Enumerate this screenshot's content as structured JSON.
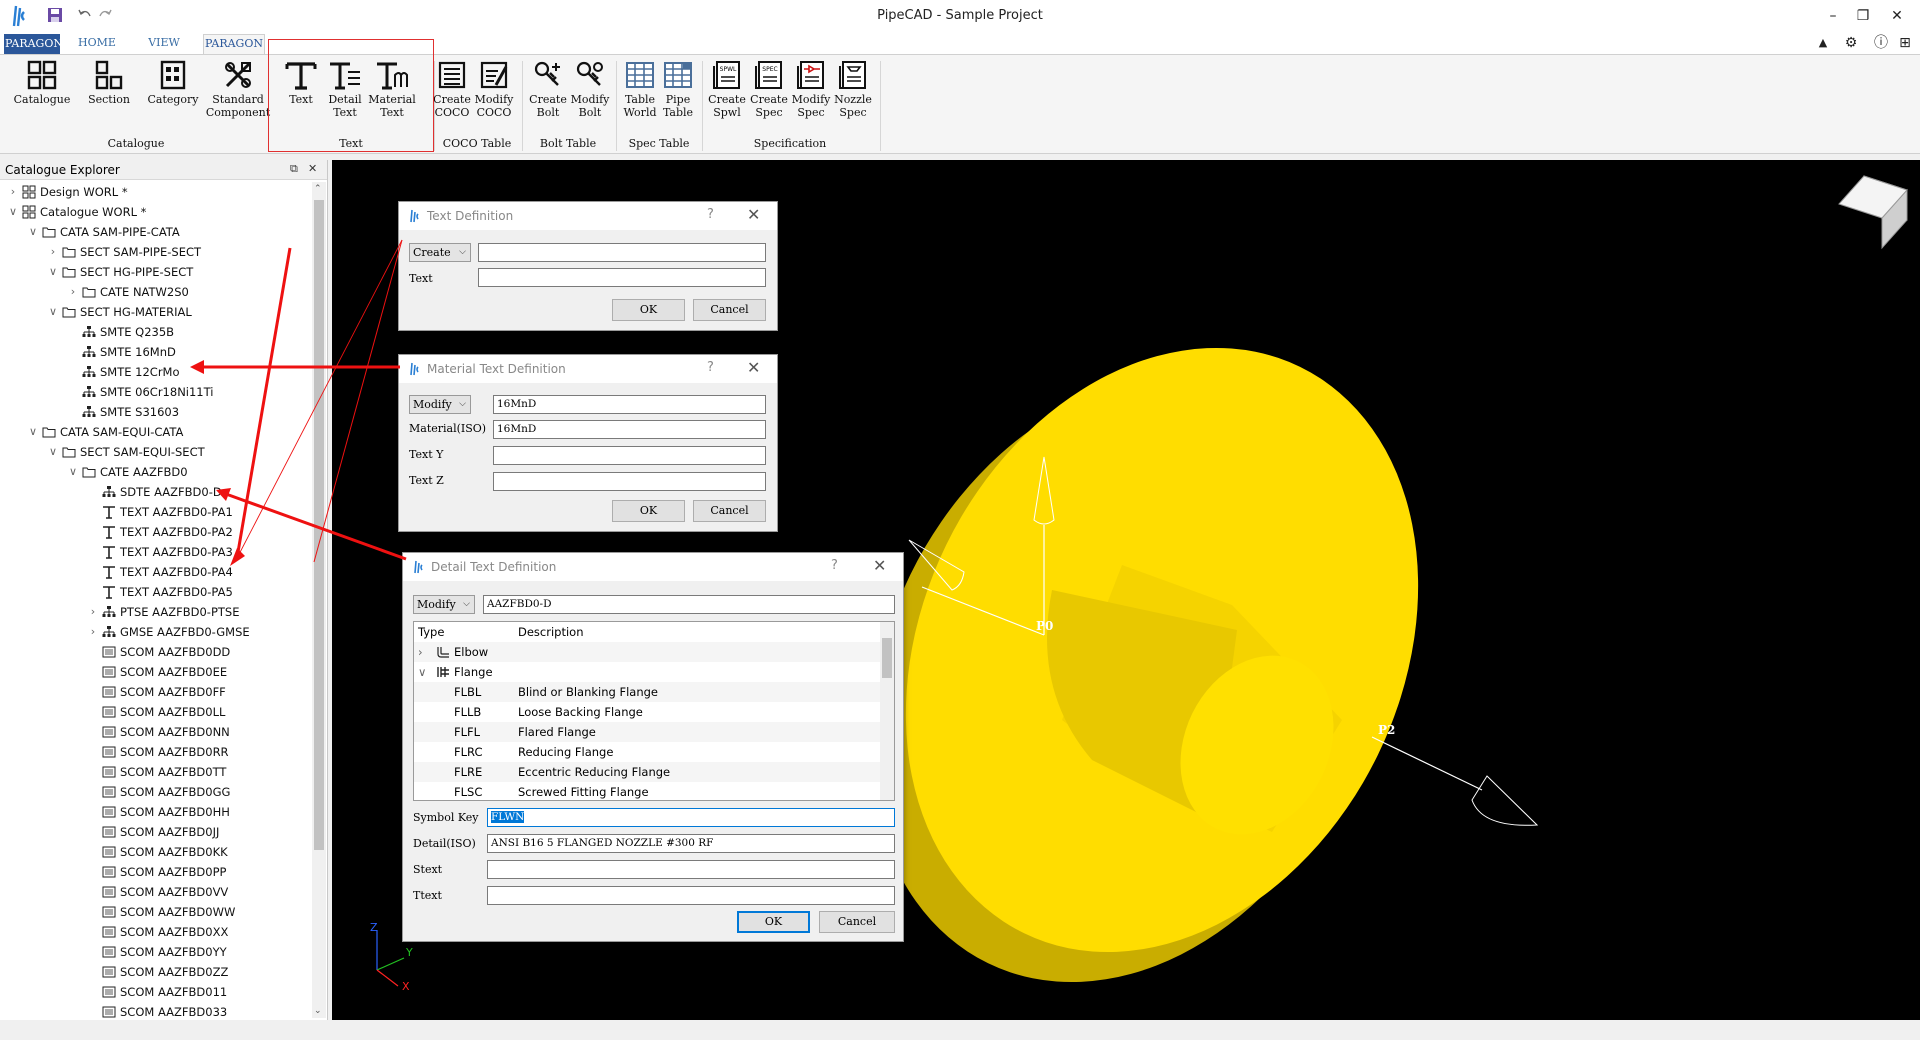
{
  "window": {
    "title": "PipeCAD - Sample Project"
  },
  "tabs": {
    "app_tab": "PARAGON",
    "home": "HOME",
    "view": "VIEW",
    "paragon": "PARAGON"
  },
  "ribbon": {
    "catalogue": "Catalogue",
    "section": "Section",
    "category": "Category",
    "standard_1": "Standard",
    "standard_2": "Component",
    "text": "Text",
    "detail_text_1": "Detail",
    "detail_text_2": "Text",
    "material_text_1": "Material",
    "material_text_2": "Text",
    "create_coco_1": "Create",
    "create_coco_2": "COCO",
    "modify_coco_1": "Modify",
    "modify_coco_2": "COCO",
    "create_bolt_1": "Create",
    "create_bolt_2": "Bolt",
    "modify_bolt_1": "Modify",
    "modify_bolt_2": "Bolt",
    "table_world_1": "Table",
    "table_world_2": "World",
    "pipe_table_1": "Pipe",
    "pipe_table_2": "Table",
    "create_spwl_1": "Create",
    "create_spwl_2": "Spwl",
    "create_spec_1": "Create",
    "create_spec_2": "Spec",
    "modify_spec_1": "Modify",
    "modify_spec_2": "Spec",
    "nozzle_spec_1": "Nozzle",
    "nozzle_spec_2": "Spec",
    "group_catalogue": "Catalogue",
    "group_text": "Text",
    "group_coco": "COCO Table",
    "group_bolt": "Bolt Table",
    "group_spec_table": "Spec Table",
    "group_specification": "Specification"
  },
  "explorer": {
    "title": "Catalogue Explorer",
    "items": [
      "Design WORL *",
      "Catalogue WORL *",
      "CATA SAM-PIPE-CATA",
      "SECT SAM-PIPE-SECT",
      "SECT HG-PIPE-SECT",
      "CATE NATW2S0",
      "SECT HG-MATERIAL",
      "SMTE Q235B",
      "SMTE 16MnD",
      "SMTE 12CrMo",
      "SMTE 06Cr18Ni11Ti",
      "SMTE S31603",
      "CATA SAM-EQUI-CATA",
      "SECT SAM-EQUI-SECT",
      "CATE AAZFBD0",
      "SDTE AAZFBD0-D",
      "TEXT AAZFBD0-PA1",
      "TEXT AAZFBD0-PA2",
      "TEXT AAZFBD0-PA3",
      "TEXT AAZFBD0-PA4",
      "TEXT AAZFBD0-PA5",
      "PTSE AAZFBD0-PTSE",
      "GMSE AAZFBD0-GMSE",
      "SCOM AAZFBD0DD",
      "SCOM AAZFBD0EE",
      "SCOM AAZFBD0FF",
      "SCOM AAZFBD0LL",
      "SCOM AAZFBD0NN",
      "SCOM AAZFBD0RR",
      "SCOM AAZFBD0TT",
      "SCOM AAZFBD0GG",
      "SCOM AAZFBD0HH",
      "SCOM AAZFBD0JJ",
      "SCOM AAZFBD0KK",
      "SCOM AAZFBD0PP",
      "SCOM AAZFBD0VV",
      "SCOM AAZFBD0WW",
      "SCOM AAZFBD0XX",
      "SCOM AAZFBD0YY",
      "SCOM AAZFBD0ZZ",
      "SCOM AAZFBD011",
      "SCOM AAZFBD033"
    ]
  },
  "text_dialog": {
    "title": "Text Definition",
    "help": "?",
    "mode": "Create",
    "mode_value": "",
    "text_label": "Text",
    "text_value": "",
    "ok": "OK",
    "cancel": "Cancel"
  },
  "material_dialog": {
    "title": "Material Text Definition",
    "help": "?",
    "mode": "Modify",
    "mode_value": "16MnD",
    "material_label": "Material(ISO)",
    "material_value": "16MnD",
    "texty_label": "Text Y",
    "texty_value": "",
    "textz_label": "Text Z",
    "textz_value": "",
    "ok": "OK",
    "cancel": "Cancel"
  },
  "detail_dialog": {
    "title": "Detail Text Definition",
    "help": "?",
    "mode": "Modify",
    "mode_value": "AAZFBD0-D",
    "col_type": "Type",
    "col_desc": "Description",
    "tree": [
      {
        "type": "Elbow",
        "desc": ""
      },
      {
        "type": "Flange",
        "desc": ""
      },
      {
        "type": "FLBL",
        "desc": "Blind or Blanking Flange"
      },
      {
        "type": "FLLB",
        "desc": "Loose Backing Flange"
      },
      {
        "type": "FLFL",
        "desc": "Flared Flange"
      },
      {
        "type": "FLRC",
        "desc": "Reducing Flange"
      },
      {
        "type": "FLRE",
        "desc": "Eccentric Reducing Flange"
      },
      {
        "type": "FLSC",
        "desc": "Screwed Fitting Flange"
      }
    ],
    "symbol_label": "Symbol Key",
    "symbol_value": "FLWN",
    "detail_label": "Detail(ISO)",
    "detail_value": "ANSI B16 5 FLANGED NOZZLE #300 RF",
    "stext_label": "Stext",
    "stext_value": "",
    "ttext_label": "Ttext",
    "ttext_value": "",
    "ok": "OK",
    "cancel": "Cancel"
  },
  "viewport": {
    "p0": "P0",
    "p2": "P2",
    "axis_x": "X",
    "axis_y": "Y",
    "axis_z": "Z",
    "colors": {
      "body": "#ffdd00",
      "side": "#d4b400",
      "dark_side": "#b89c00",
      "background": "#000000",
      "annotation": "#ee1111"
    }
  }
}
